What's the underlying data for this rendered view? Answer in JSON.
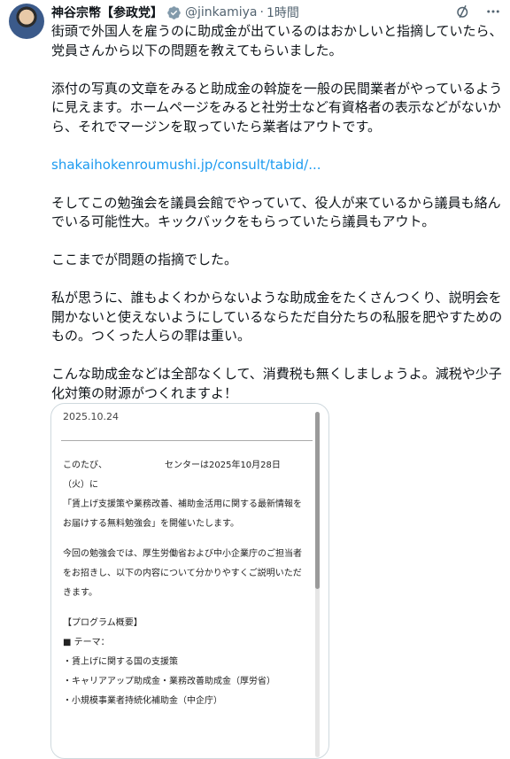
{
  "author": {
    "display_name": "神谷宗幣【参政党】",
    "handle": "@jinkamiya",
    "separator": "·",
    "time": "1時間"
  },
  "icons": {
    "verified": "verified-badge-icon",
    "grok": "grok-icon",
    "more": "more-dots-icon"
  },
  "post": {
    "p1a": "街頭で外国人を雇うのに助成金が出ているのはおかしいと指摘していたら、",
    "p1b": "党員さんから以下の問題を教えてもらいました。",
    "p2a": "添付の写真の文章をみると助成金の斡旋を一般の民間業者がやっているよう",
    "p2b": "に見えます。ホームページをみると社労士など有資格者の表示などがないか",
    "p2c": "ら、それでマージンを取っていたら業者はアウトです。",
    "link": "shakaihokenroumushi.jp/consult/tabid/...",
    "p3a": "そしてこの勉強会を議員会館でやっていて、役人が来ているから議員も絡ん",
    "p3b": "でいる可能性大。キックバックをもらっていたら議員もアウト。",
    "p4": "ここまでが問題の指摘でした。",
    "p5a": "私が思うに、誰もよくわからないような助成金をたくさんつくり、説明会を",
    "p5b": "開かないと使えないようにしているならただ自分たちの私服を肥やすための",
    "p5c": "もの。つくった人らの罪は重い。",
    "p6a": "こんな助成金などは全部なくして、消費税も無くしましょうよ。減税や少子",
    "p6b": "化対策の財源がつくれますよ！"
  },
  "image_doc": {
    "date": "2025.10.24",
    "l1": "このたび、　　　　　　　センターは2025年10月28日",
    "l2": "（火）に",
    "l3": "「賃上げ支援策や業務改善、補助金活用に関する最新情報を",
    "l4": "お届けする無料勉強会」を開催いたします。",
    "l5": "今回の勉強会では、厚生労働省および中小企業庁のご担当者",
    "l6": "をお招きし、以下の内容について分かりやすくご説明いただ",
    "l7": "きます。",
    "l8": "【プログラム概要】",
    "l9": "■ テーマ：",
    "l10": "・賃上げに関する国の支援策",
    "l11": "・キャリアアップ助成金・業務改善助成金（厚労省）",
    "l12": "・小規模事業者持続化補助金（中企庁）"
  },
  "colors": {
    "link": "#1d9bf0",
    "verified": "#829aab",
    "secondary_text": "#536471"
  }
}
